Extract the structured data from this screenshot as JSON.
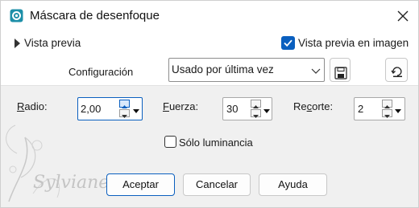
{
  "window": {
    "title": "Máscara de desenfoque",
    "icon": "blur-app-icon",
    "close_icon": "close-icon"
  },
  "preview": {
    "toggle_label": "Vista previa",
    "image_preview_label": "Vista previa en imagen",
    "image_preview_checked": true
  },
  "config": {
    "label": "Configuración",
    "selected": "Usado por última vez",
    "save_icon": "save-icon",
    "reset_icon": "reset-icon"
  },
  "params": {
    "radio": {
      "label": "Radio:",
      "value": "2,00"
    },
    "fuerza": {
      "label": "Fuerza:",
      "value": "30"
    },
    "recorte": {
      "label": "Recorte:",
      "value": "2"
    }
  },
  "luminance": {
    "label": "Sólo luminancia",
    "checked": false
  },
  "watermark": {
    "text": "Sylviane"
  },
  "buttons": {
    "ok": "Aceptar",
    "cancel": "Cancelar",
    "help": "Ayuda"
  },
  "colors": {
    "accent": "#0a5fbf",
    "icon_teal": "#1d8fa8",
    "window_bg": "#f0f0f0"
  }
}
